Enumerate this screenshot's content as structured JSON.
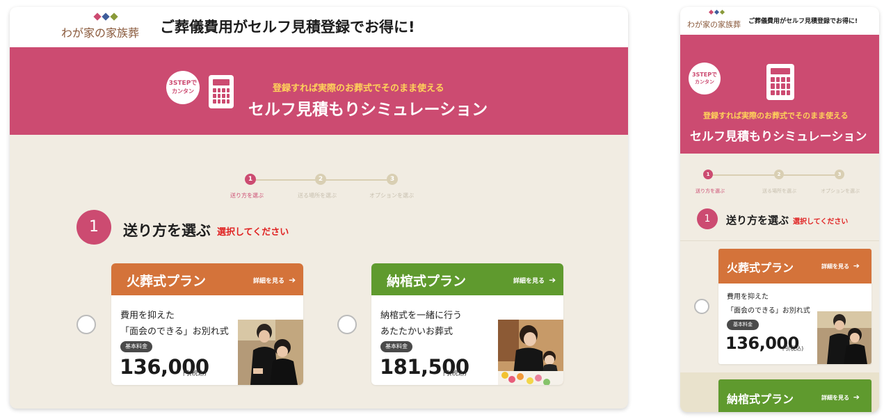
{
  "brand": {
    "logo_text": "わが家の家族葬",
    "diamond_colors": [
      "#cc4b71",
      "#3f5d9b",
      "#8a9a3a"
    ]
  },
  "header": {
    "title": "ご葬儀費用がセルフ見積登録でお得に!"
  },
  "banner": {
    "badge_line1": "3STEPで",
    "badge_line2": "カンタン",
    "subtitle": "登録すれば実際のお葬式でそのまま使える",
    "title": "セルフ見積もりシミュレーション",
    "calculator_icon": "calculator-icon"
  },
  "stepper": {
    "steps": [
      {
        "num": "1",
        "label": "送り方を選ぶ",
        "active": true
      },
      {
        "num": "2",
        "label": "送る場所を選ぶ",
        "active": false
      },
      {
        "num": "3",
        "label": "オプションを選ぶ",
        "active": false
      }
    ]
  },
  "section": {
    "number": "1",
    "title": "送り方を選ぶ",
    "note": "選択してください"
  },
  "plans": [
    {
      "name": "火葬式プラン",
      "more": "詳細を見る",
      "more_icon": "arrow-right-icon",
      "desc_line1": "費用を抑えた",
      "desc_line2": "「面会のできる」お別れ式",
      "pill": "基本料金",
      "price": "136,000",
      "yen": "円(税込)",
      "header_color": "#d4733a",
      "selected": false
    },
    {
      "name": "納棺式プラン",
      "more": "詳細を見る",
      "more_icon": "arrow-right-icon",
      "desc_line1": "納棺式を一緒に行う",
      "desc_line2": "あたたかいお葬式",
      "pill": "基本料金",
      "price": "181,500",
      "yen": "円(税込)",
      "header_color": "#5f9a2e",
      "selected": false
    }
  ],
  "colors": {
    "brand_pink": "#cc4b71",
    "accent_yellow": "#ffd35a",
    "background_beige": "#f1ece2",
    "note_red": "#e02222"
  }
}
